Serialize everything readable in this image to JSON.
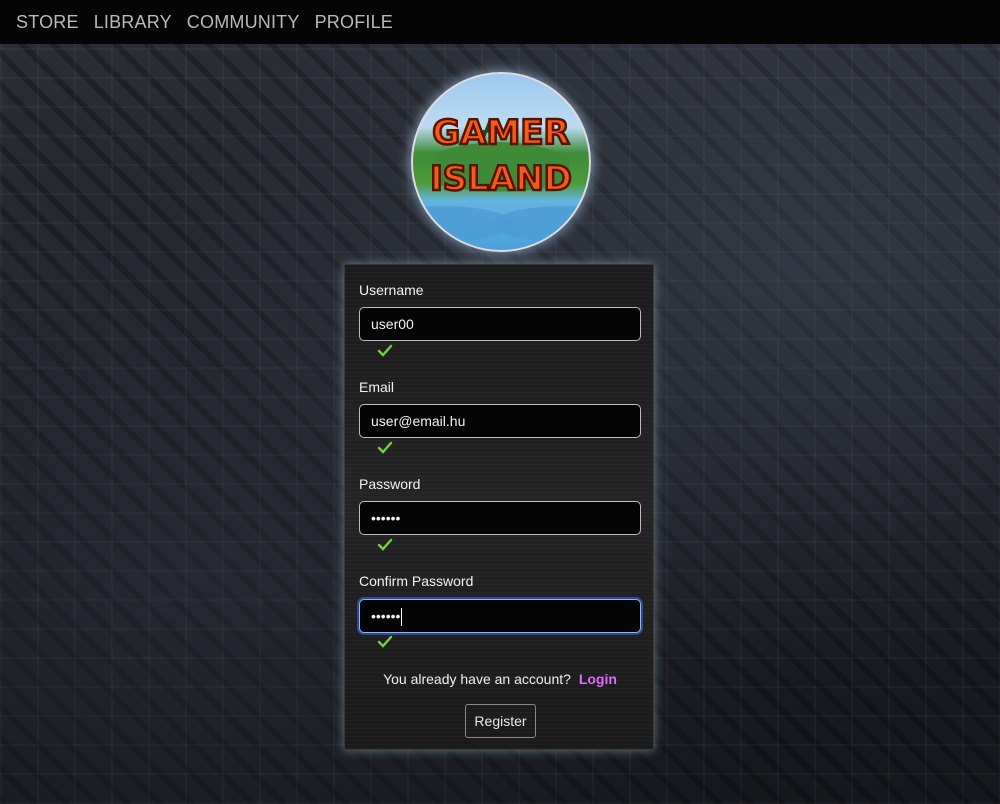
{
  "nav": {
    "items": [
      "STORE",
      "LIBRARY",
      "COMMUNITY",
      "PROFILE"
    ]
  },
  "logo": {
    "line1": "GAMER",
    "line2": "ISLAND"
  },
  "form": {
    "username": {
      "label": "Username",
      "value": "user00",
      "valid": true
    },
    "email": {
      "label": "Email",
      "value": "user@email.hu",
      "valid": true
    },
    "password": {
      "label": "Password",
      "value": "••••••",
      "valid": true
    },
    "confirm_password": {
      "label": "Confirm Password",
      "value": "••••••",
      "valid": true
    },
    "login_prompt": "You already have an account?",
    "login_link": "Login",
    "register_button": "Register"
  },
  "colors": {
    "accent_link": "#e06bff",
    "check": "#6fd14a",
    "focus": "#8fb3ff"
  }
}
